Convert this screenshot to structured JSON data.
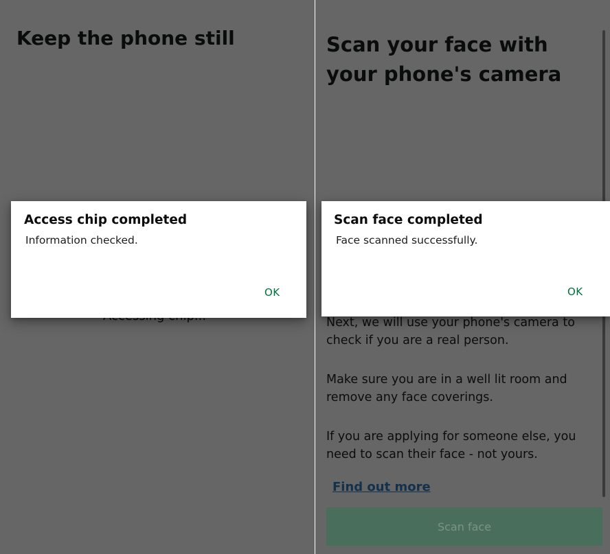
{
  "left_screen": {
    "title": "Keep the phone still",
    "partial_text": "Accessing chip...",
    "dialog": {
      "title": "Access chip completed",
      "message": "Information checked.",
      "ok_label": "OK"
    }
  },
  "right_screen": {
    "title": "Scan your face with your phone's camera",
    "paragraphs": [
      "Next, we will use your phone's camera to check if you are a real person.",
      "Make sure you are in a well lit room and remove any face coverings.",
      "If you are applying for someone else, you need to scan their face - not yours."
    ],
    "link_label": "Find out more",
    "button_label": "Scan face",
    "dialog": {
      "title": "Scan face completed",
      "message": "Face scanned successfully.",
      "ok_label": "OK"
    }
  },
  "colors": {
    "scrim": "#666666",
    "primary_green": "#00703c",
    "link": "#12314d"
  }
}
